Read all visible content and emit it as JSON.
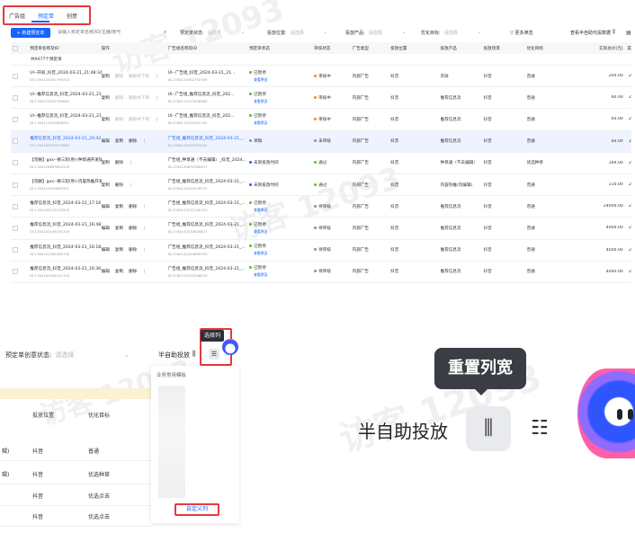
{
  "tabs": [
    "广告组",
    "预定单",
    "创意"
  ],
  "toolbar": {
    "new_button": "+ 新建预定单",
    "search_placeholder": "请输入预定单名称/ID/主播/账号",
    "filters": [
      {
        "label": "预定单状态:",
        "placeholder": "请选择"
      },
      {
        "label": "投放位置:",
        "placeholder": "请选择"
      },
      {
        "label": "投放产品:",
        "placeholder": "请选择"
      },
      {
        "label": "优化目标:",
        "placeholder": "请选择"
      }
    ],
    "more_filter": "更多筛选",
    "view_data": "查看半自助代投数据"
  },
  "table": {
    "headers": [
      "预定单名称及ID",
      "操作",
      "广告组名称及ID",
      "预定单状态",
      "审核状态",
      "广告类型",
      "投放位置",
      "投放产品",
      "投放场景",
      "优化目标",
      "实际总价(元)",
      "其"
    ],
    "summary": "共9477个预定单",
    "rows": [
      {
        "name": "UI--开屏_抖音_2024-03-21_21:48:34",
        "id": "ID:1784123452798715",
        "ops": [
          "复制",
          "删除",
          "删除并下单"
        ],
        "ad": "UI--广告组_抖音_2024-03-21_21...",
        "ad_id": "ID:1784123452792309",
        "status": "已暂停",
        "status_sub": "查看原因",
        "dot": "#52c41a",
        "review": "审核中",
        "rdot": "#ff8a00",
        "type": "内部广告",
        "pos": "抖音",
        "product": "开屏",
        "scene": "抖音",
        "opt": "普通",
        "amount": "200.00",
        "x": "2",
        "hl": false
      },
      {
        "name": "UI--推荐信息流_抖音_2024-03-21_21:0...",
        "id": "ID:1784123452799663",
        "ops": [
          "复制",
          "删除",
          "删除并下单"
        ],
        "ad": "UI--广告组_推荐信息流_抖音_202...",
        "ad_id": "ID:1784121523046983",
        "status": "已暂停",
        "status_sub": "查看原因",
        "dot": "#52c41a",
        "review": "审核中",
        "rdot": "#ff8a00",
        "type": "内部广告",
        "pos": "抖音",
        "product": "推荐信息流",
        "scene": "抖音",
        "opt": "普通",
        "amount": "60.00",
        "x": "2",
        "hl": false
      },
      {
        "name": "UI--推荐信息流_抖音_2024-03-21_21:2...",
        "id": "ID:1784112952836051",
        "ops": [
          "复制",
          "删除",
          "删除并下单"
        ],
        "ad": "UI--广告组_推荐信息流_抖音_202...",
        "ad_id": "ID:1784112152302702",
        "status": "已暂停",
        "status_sub": "查看原因",
        "dot": "#52c41a",
        "review": "审核中",
        "rdot": "#ff8a00",
        "type": "内部广告",
        "pos": "抖音",
        "product": "推荐信息流",
        "scene": "抖音",
        "opt": "普通",
        "amount": "60.00",
        "x": "2",
        "hl": false
      },
      {
        "name": "推荐信息流_抖音_2024-03-21_20:42:32",
        "id": "ID:1784102029075663",
        "ops": [
          "编辑",
          "复制",
          "删除"
        ],
        "ad": "广告组_推荐信息流_抖音_2024-03-21_...",
        "ad_id": "ID:1784102025781924",
        "status": "草稿",
        "status_sub": "",
        "dot": "#86909c",
        "review": "未审核",
        "rdot": "#86909c",
        "type": "内部广告",
        "pos": "抖音",
        "product": "推荐信息流",
        "scene": "抖音",
        "opt": "普通",
        "amount": "60.00",
        "x": "2",
        "hl": true
      },
      {
        "name": "【勿删】gxx--要三轮(秒)-种草通开发辅助",
        "id": "ID:1784126893645229",
        "ops": [
          "复制",
          "删除"
        ],
        "ad": "广告组_种草通（不去编辑）_抖音_2024...",
        "ad_id": "ID:1784126832586417",
        "status": "未到投放时间",
        "status_sub": "",
        "dot": "#1664ff",
        "review": "通过",
        "rdot": "#52c41a",
        "type": "内部广告",
        "pos": "抖音",
        "product": "种草通（不去编辑）",
        "scene": "抖音",
        "opt": "优选种草",
        "amount": "169.00",
        "x": "2",
        "hl": false
      },
      {
        "name": "【勿删】gxx--要三轮(秒)-内容热推开发辅助",
        "id": "ID:1784124429893307",
        "ops": [
          "复制",
          "删除"
        ],
        "ad": "广告组_推荐信息流_抖音_2024-03-21_...",
        "ad_id": "ID:1784124294226375",
        "status": "未到投放时间",
        "status_sub": "",
        "dot": "#1664ff",
        "review": "通过",
        "rdot": "#52c41a",
        "type": "内部广告",
        "pos": "抖音",
        "product": "内容热推(勿编辑)",
        "scene": "抖音",
        "opt": "普通",
        "amount": "110.00",
        "x": "2",
        "hl": false
      },
      {
        "name": "推荐信息流_抖音_2024-03-21_17:16:36",
        "id": "ID:1784103212143203",
        "ops": [
          "编辑",
          "复制",
          "删除"
        ],
        "ad": "广告组_推荐信息流_抖音_2024-03-21_...",
        "ad_id": "ID:1784103212140723",
        "status": "已暂停",
        "status_sub": "查看原因",
        "dot": "#52c41a",
        "review": "待审核",
        "rdot": "#86909c",
        "type": "内部广告",
        "pos": "抖音",
        "product": "推荐信息流",
        "scene": "抖音",
        "opt": "普通",
        "amount": "24000.00",
        "x": "2",
        "hl": false
      },
      {
        "name": "推荐信息流_抖音_2024-03-21_16:48:0...",
        "id": "ID:1784102546191320",
        "ops": [
          "编辑",
          "复制",
          "删除"
        ],
        "ad": "广告组_推荐信息流_抖音_2024-03-21_...",
        "ad_id": "ID:1784102534649827",
        "status": "已暂停",
        "status_sub": "查看原因",
        "dot": "#52c41a",
        "review": "待审核",
        "rdot": "#86909c",
        "type": "内部广告",
        "pos": "抖音",
        "product": "推荐信息流",
        "scene": "抖音",
        "opt": "普通",
        "amount": "4000.00",
        "x": "2",
        "hl": false
      },
      {
        "name": "推荐信息流_抖音_2024-03-21_16:18:01",
        "id": "ID:1784102445185730",
        "ops": [
          "编辑",
          "复制",
          "删除"
        ],
        "ad": "广告组_推荐信息流_抖音_2024-03-21_...",
        "ad_id": "ID:1784102424669350",
        "status": "已暂停",
        "status_sub": "查看原因",
        "dot": "#52c41a",
        "review": "待审核",
        "rdot": "#86909c",
        "type": "内部广告",
        "pos": "抖音",
        "product": "推荐信息流",
        "scene": "抖音",
        "opt": "普通",
        "amount": "4000.00",
        "x": "2",
        "hl": false
      },
      {
        "name": "推荐信息流_抖音_2024-03-21_16:36:1...",
        "id": "ID:1784102546151319",
        "ops": [
          "编辑",
          "复制",
          "删除"
        ],
        "ad": "广告组_推荐信息流_抖音_2024-03-21_...",
        "ad_id": "ID:1784102532096519",
        "status": "已暂停",
        "status_sub": "查看原因",
        "dot": "#52c41a",
        "review": "待审核",
        "rdot": "#86909c",
        "type": "内部广告",
        "pos": "抖音",
        "product": "推荐信息流",
        "scene": "抖音",
        "opt": "普通",
        "amount": "4040.00",
        "x": "2",
        "hl": false
      }
    ]
  },
  "zoom_small": {
    "filter_label": "预定单创意状态:",
    "filter_placeholder": "请选择",
    "semi_auto": "半自助投放",
    "tooltip": "选择列",
    "headers": [
      "",
      "投放位置",
      "优化目标"
    ],
    "rows": [
      {
        "c0": "辑)",
        "c1": "抖音",
        "c2": "普通"
      },
      {
        "c0": "辑)",
        "c1": "抖音",
        "c2": "优选种草"
      },
      {
        "c0": "",
        "c1": "抖音",
        "c2": "优选点击"
      },
      {
        "c0": "",
        "c1": "抖音",
        "c2": "优选点击"
      }
    ],
    "panel_title": "业务常用模板",
    "custom_columns": "自定义列"
  },
  "zoom_large": {
    "tooltip": "重置列宽",
    "semi_auto": "半自助投放"
  },
  "colors": {
    "primary": "#1664ff",
    "highlight": "#e8383d"
  }
}
